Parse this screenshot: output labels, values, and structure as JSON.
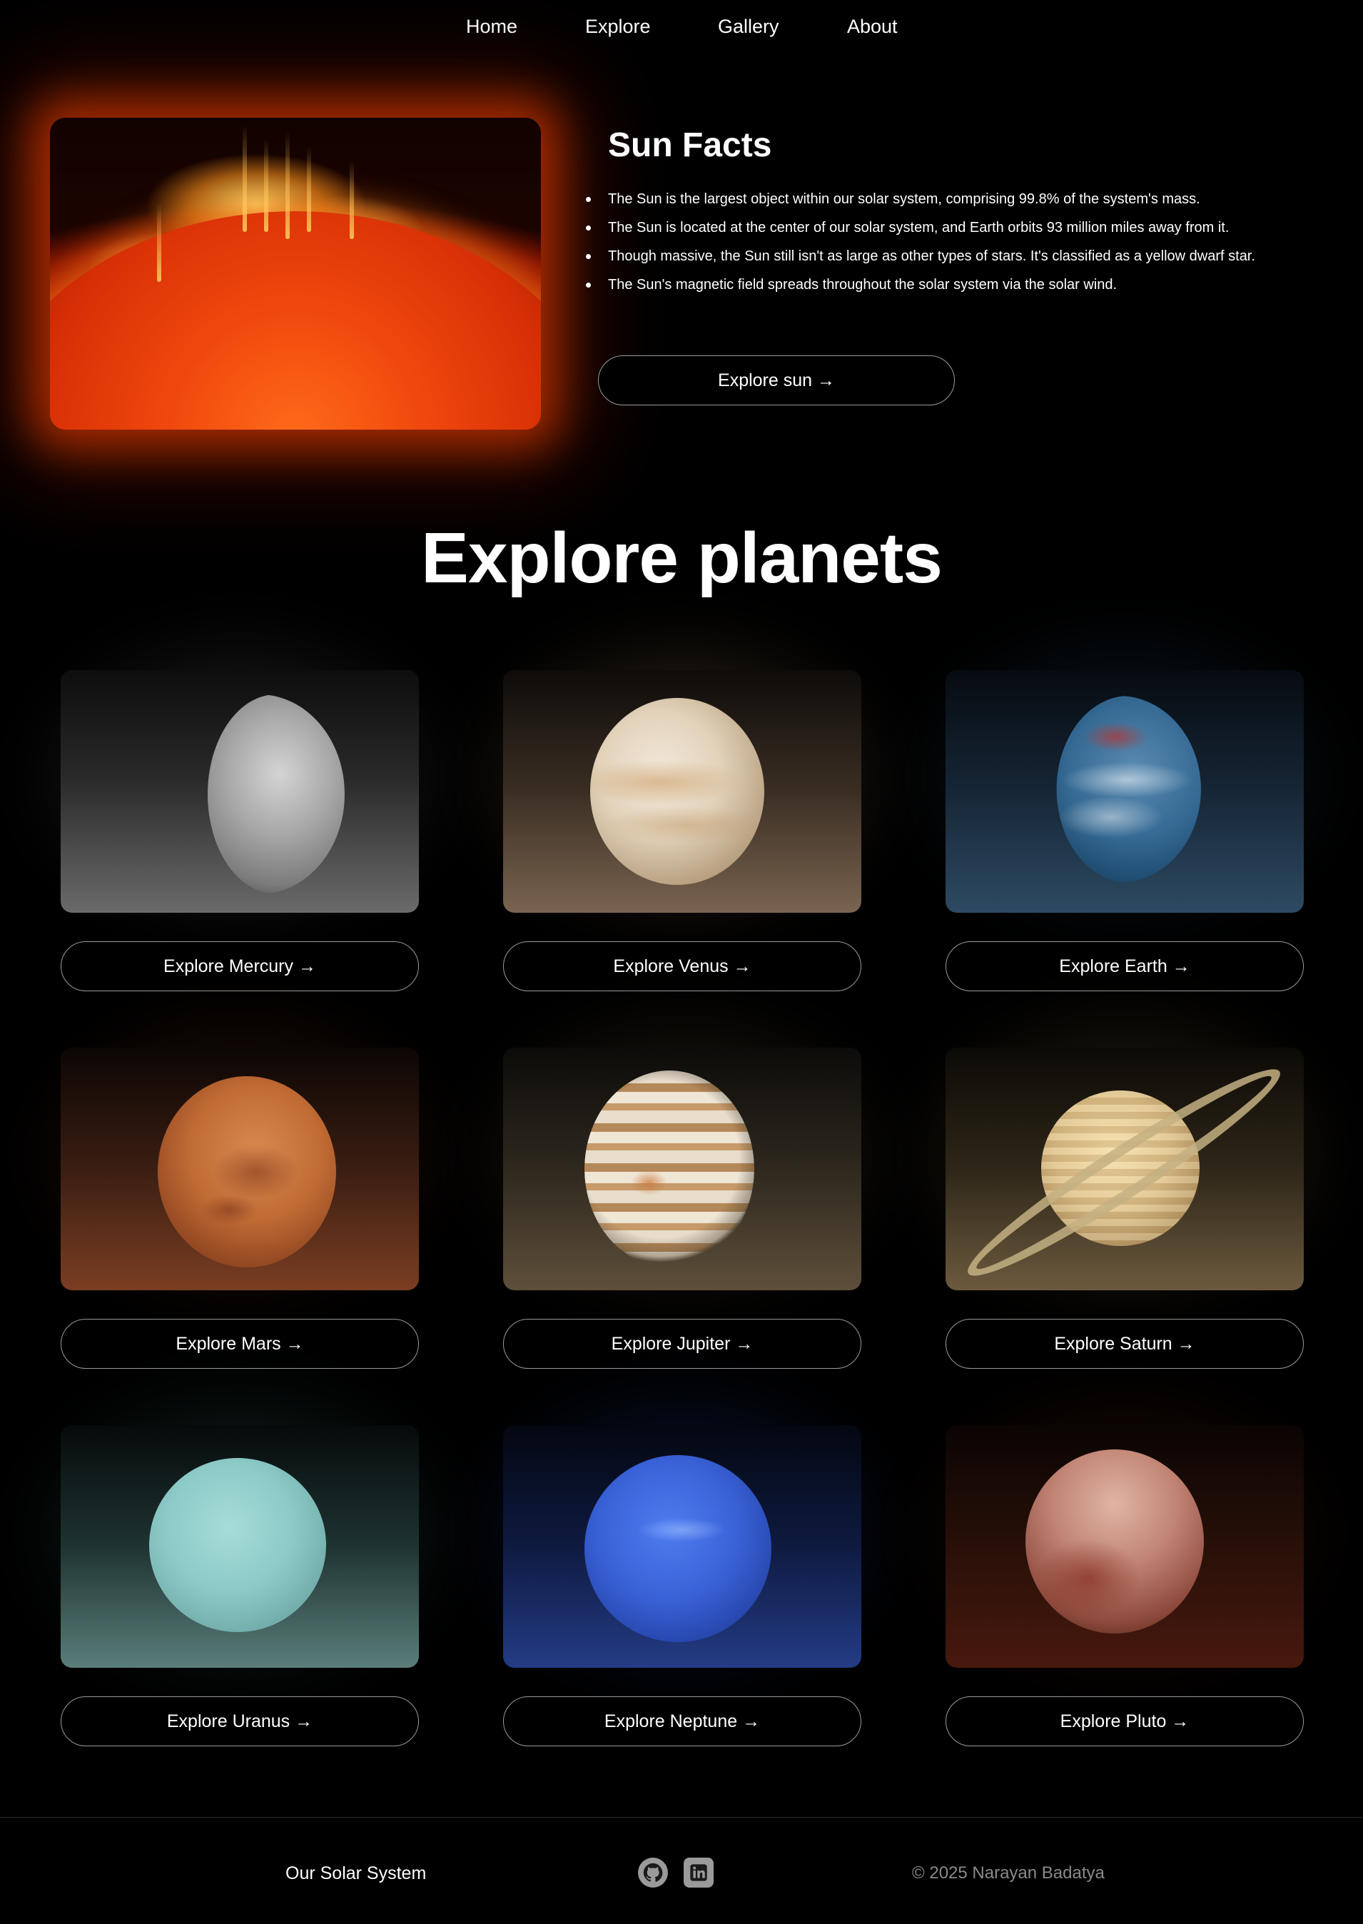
{
  "nav": {
    "items": [
      "Home",
      "Explore",
      "Gallery",
      "About"
    ]
  },
  "sun": {
    "title": "Sun Facts",
    "facts": [
      "The Sun is the largest object within our solar system, comprising 99.8% of the system's mass.",
      "The Sun is located at the center of our solar system, and Earth orbits 93 million miles away from it.",
      "Though massive, the Sun still isn't as large as other types of stars. It's classified as a yellow dwarf star.",
      "The Sun's magnetic field spreads throughout the solar system via the solar wind."
    ],
    "button_label": "Explore sun →"
  },
  "planets_section": {
    "title": "Explore planets",
    "planets": [
      {
        "name": "Mercury",
        "button_label": "Explore Mercury →",
        "color": "#9a9a9a"
      },
      {
        "name": "Venus",
        "button_label": "Explore Venus →",
        "color": "#d9c3a0"
      },
      {
        "name": "Earth",
        "button_label": "Explore Earth →",
        "color": "#3f74a0"
      },
      {
        "name": "Mars",
        "button_label": "Explore Mars →",
        "color": "#c06a34"
      },
      {
        "name": "Jupiter",
        "button_label": "Explore Jupiter →",
        "color": "#c7a57a"
      },
      {
        "name": "Saturn",
        "button_label": "Explore Saturn →",
        "color": "#d8c08a"
      },
      {
        "name": "Uranus",
        "button_label": "Explore Uranus →",
        "color": "#8ccac8"
      },
      {
        "name": "Neptune",
        "button_label": "Explore Neptune →",
        "color": "#3a62d8"
      },
      {
        "name": "Pluto",
        "button_label": "Explore Pluto →",
        "color": "#b06a5a"
      }
    ]
  },
  "footer": {
    "brand": "Our Solar System",
    "icons": [
      "github-icon",
      "linkedin-icon"
    ],
    "copyright": "© 2025 Narayan Badatya"
  }
}
